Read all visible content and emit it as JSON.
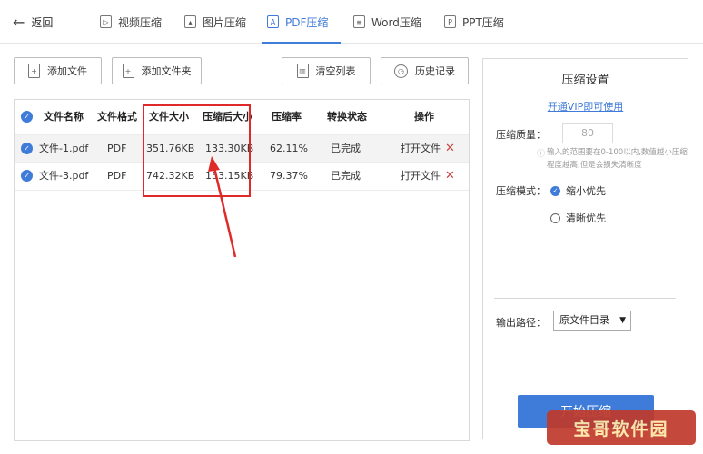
{
  "nav": {
    "back_label": "返回",
    "tabs": [
      {
        "label": "视频压缩",
        "icon": "video-icon"
      },
      {
        "label": "图片压缩",
        "icon": "image-icon"
      },
      {
        "label": "PDF压缩",
        "icon": "pdf-icon",
        "active": true
      },
      {
        "label": "Word压缩",
        "icon": "word-icon"
      },
      {
        "label": "PPT压缩",
        "icon": "ppt-icon"
      }
    ]
  },
  "toolbar": {
    "add_file": "添加文件",
    "add_folder": "添加文件夹",
    "clear_list": "清空列表",
    "history": "历史记录"
  },
  "table": {
    "headers": {
      "name": "文件名称",
      "format": "文件格式",
      "size": "文件大小",
      "compressed_size": "压缩后大小",
      "ratio": "压缩率",
      "status": "转换状态",
      "action": "操作"
    },
    "rows": [
      {
        "name": "文件-1.pdf",
        "format": "PDF",
        "size": "351.76KB",
        "compressed_size": "133.30KB",
        "ratio": "62.11%",
        "status": "已完成",
        "action": "打开文件"
      },
      {
        "name": "文件-3.pdf",
        "format": "PDF",
        "size": "742.32KB",
        "compressed_size": "153.15KB",
        "ratio": "79.37%",
        "status": "已完成",
        "action": "打开文件"
      }
    ]
  },
  "settings": {
    "title": "压缩设置",
    "vip_link": "开通VIP即可使用",
    "quality_label": "压缩质量：",
    "quality_value": "80",
    "hint": "输入的范围要在0-100以内,数值越小压缩程度越高,但是会损失清晰度",
    "mode_label": "压缩模式：",
    "mode_options": [
      "缩小优先",
      "清晰优先"
    ],
    "output_label": "输出路径：",
    "output_value": "原文件目录",
    "start_button": "开始压缩"
  },
  "watermark": "宝哥软件园",
  "colors": {
    "accent": "#3f7bd8",
    "highlight": "#e02a2a"
  }
}
